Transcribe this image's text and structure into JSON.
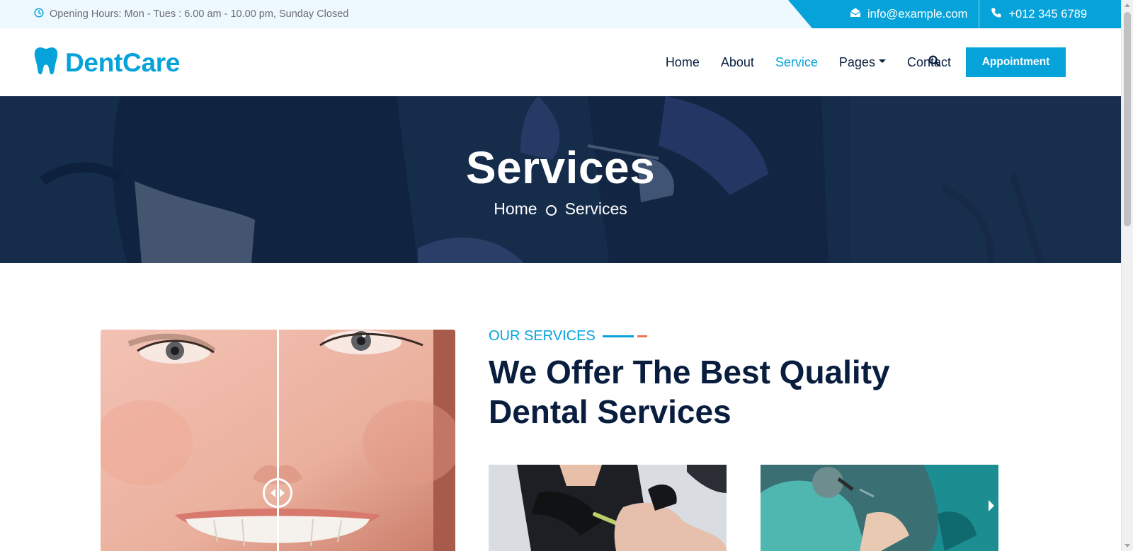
{
  "topbar": {
    "hours_text": "Opening Hours: Mon - Tues : 6.00 am - 10.00 pm, Sunday Closed",
    "email": "info@example.com",
    "phone": "+012 345 6789"
  },
  "brand": {
    "name": "DentCare"
  },
  "nav": {
    "items": [
      {
        "label": "Home"
      },
      {
        "label": "About"
      },
      {
        "label": "Service",
        "active": true
      },
      {
        "label": "Pages",
        "dropdown": true
      },
      {
        "label": "Contact"
      }
    ],
    "appointment_label": "Appointment"
  },
  "hero": {
    "title": "Services",
    "breadcrumb": [
      "Home",
      "Services"
    ]
  },
  "services": {
    "subtitle": "OUR SERVICES",
    "title_line1": "We Offer The Best Quality",
    "title_line2": "Dental Services"
  },
  "colors": {
    "primary": "#06a3da",
    "dark": "#091e3e",
    "accent": "#ea7553",
    "topbar_bg": "#eef9ff"
  },
  "icons": {
    "hours": "clock-icon",
    "email": "envelope-open-icon",
    "phone": "phone-icon",
    "logo": "tooth-icon",
    "search": "search-icon",
    "compare_handle": "left-right-arrows-icon"
  }
}
